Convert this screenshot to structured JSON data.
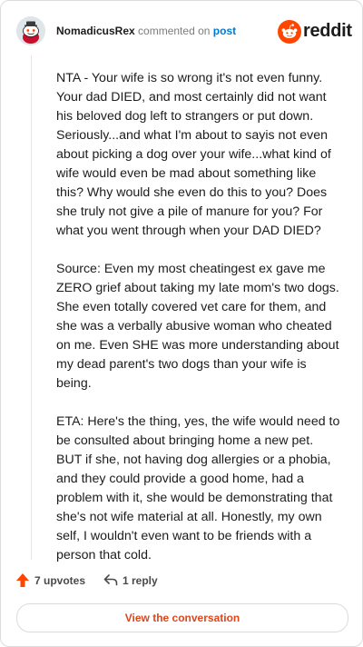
{
  "header": {
    "username": "NomadicusRex",
    "commented_on": "commented on",
    "post_link": "post",
    "brand_text": "reddit"
  },
  "comment": {
    "paragraphs": [
      "NTA - Your wife is so wrong it's not even funny. Your dad DIED, and most certainly did not want his beloved dog left to strangers or put down. Seriously...and what I'm about to sayis not even about picking a dog over your wife...what kind of wife would even be mad about something like this? Why would she even do this to you? Does she truly not give a pile of manure for you? For what you went through when your DAD DIED?",
      "Source: Even my most cheatingest ex gave me ZERO grief about taking my late mom's two dogs. She even totally covered vet care for them, and she was a verbally abusive woman who cheated on me. Even SHE was more understanding about my dead parent's two dogs than your wife is being.",
      "ETA: Here's the thing, yes, the wife would need to be consulted about bringing home a new pet. BUT if she, not having dog allergies or a phobia, and they could provide a good home, had a problem with it, she would be demonstrating that she's not wife material at all. Honestly, my own self, I wouldn't even want to be friends with a person that cold."
    ]
  },
  "actions": {
    "upvotes": "7 upvotes",
    "reply": "1 reply"
  },
  "view_button": "View the conversation",
  "colors": {
    "brand": "#ff4500",
    "link": "#0079d3",
    "button_text": "#e0451b"
  },
  "icons": [
    "snoo-avatar-icon",
    "reddit-logo-icon",
    "upvote-arrow-icon",
    "reply-arrow-icon"
  ]
}
